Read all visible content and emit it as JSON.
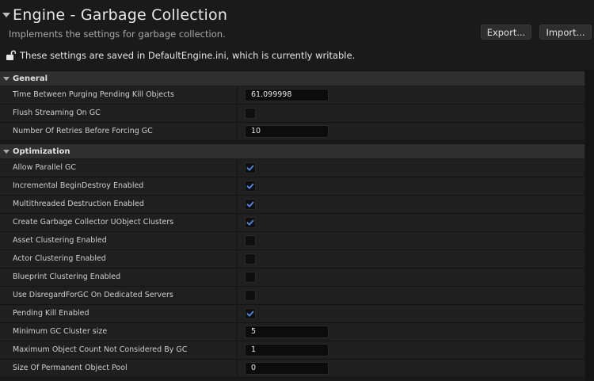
{
  "header": {
    "title": "Engine - Garbage Collection",
    "subtitle": "Implements the settings for garbage collection.",
    "export_label": "Export...",
    "import_label": "Import...",
    "notice": "These settings are saved in DefaultEngine.ini, which is currently writable."
  },
  "sections": {
    "general": "General",
    "optimization": "Optimization"
  },
  "rows": [
    {
      "label": "Time Between Purging Pending Kill Objects",
      "type": "number",
      "value": "61.099998"
    },
    {
      "label": "Flush Streaming On GC",
      "type": "checkbox",
      "checked": false
    },
    {
      "label": "Number Of Retries Before Forcing GC",
      "type": "number",
      "value": "10"
    },
    {
      "label": "Allow Parallel GC",
      "type": "checkbox",
      "checked": true
    },
    {
      "label": "Incremental BeginDestroy Enabled",
      "type": "checkbox",
      "checked": true
    },
    {
      "label": "Multithreaded Destruction Enabled",
      "type": "checkbox",
      "checked": true
    },
    {
      "label": "Create Garbage Collector UObject Clusters",
      "type": "checkbox",
      "checked": true
    },
    {
      "label": "Asset Clustering Enabled",
      "type": "checkbox",
      "checked": false
    },
    {
      "label": "Actor Clustering Enabled",
      "type": "checkbox",
      "checked": false
    },
    {
      "label": "Blueprint Clustering Enabled",
      "type": "checkbox",
      "checked": false
    },
    {
      "label": "Use DisregardForGC On Dedicated Servers",
      "type": "checkbox",
      "checked": false
    },
    {
      "label": "Pending Kill Enabled",
      "type": "checkbox",
      "checked": true
    },
    {
      "label": "Minimum GC Cluster size",
      "type": "number",
      "value": "5"
    },
    {
      "label": "Maximum Object Count Not Considered By GC",
      "type": "number",
      "value": "1"
    },
    {
      "label": "Size Of Permanent Object Pool",
      "type": "number",
      "value": "0"
    }
  ],
  "icons": {
    "title_caret": "caret-down-icon",
    "lock": "unlocked-padlock-icon",
    "check": "checkmark-icon"
  },
  "colors": {
    "check_accent": "#4a8cf0"
  }
}
